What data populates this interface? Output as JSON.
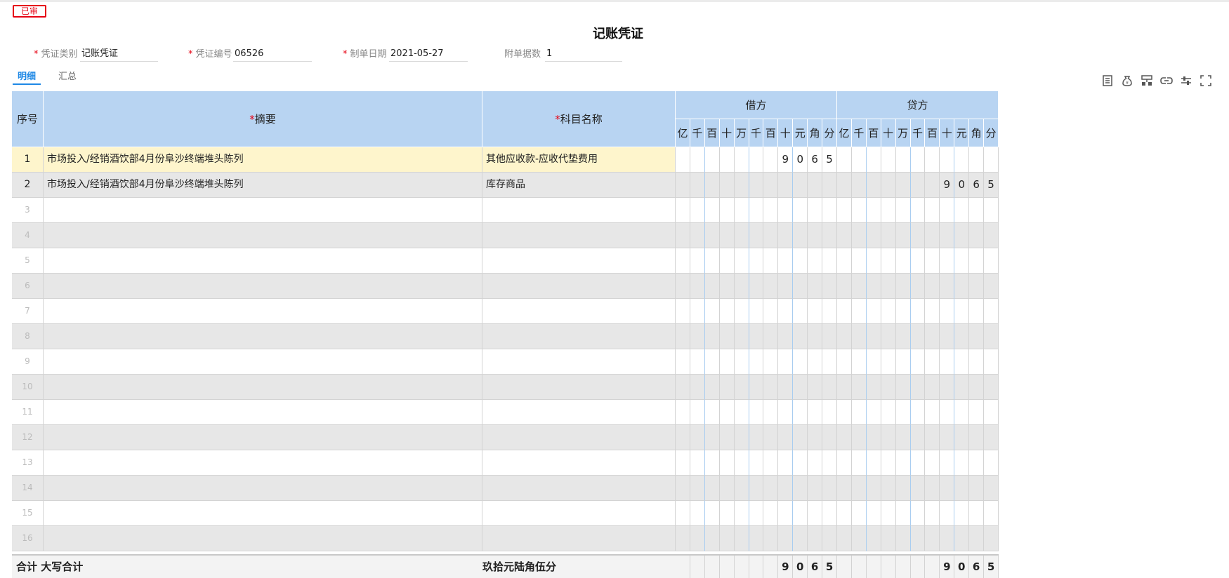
{
  "status_stamp": "已审",
  "title": "记账凭证",
  "header_fields": {
    "voucher_type": {
      "label": "凭证类别",
      "value": "记账凭证",
      "required": "*"
    },
    "voucher_no": {
      "label": "凭证编号",
      "value": "06526",
      "required": "*"
    },
    "date": {
      "label": "制单日期",
      "value": "2021-05-27",
      "required": "*"
    },
    "attachments": {
      "label": "附单据数",
      "value": "1"
    }
  },
  "tabs": {
    "detail": "明细",
    "summary": "汇总"
  },
  "toolbar_icons": [
    "list-icon",
    "money-bag-icon",
    "org-chart-icon",
    "link-icon",
    "adjust-icon",
    "fullscreen-icon"
  ],
  "table": {
    "col_seq": "序号",
    "col_summary": "摘要",
    "col_account": "科目名称",
    "required_mark": "*",
    "debit": "借方",
    "credit": "贷方",
    "digit_headers": [
      "亿",
      "千",
      "百",
      "十",
      "万",
      "千",
      "百",
      "十",
      "元",
      "角",
      "分"
    ],
    "rows": [
      {
        "seq": "1",
        "summary": "市场投入/经销酒饮部4月份阜沙终端堆头陈列",
        "account": "其他应收款-应收代垫费用",
        "debit": [
          "",
          "",
          "",
          "",
          "",
          "",
          "",
          "9",
          "0",
          "6",
          "5"
        ],
        "credit": [
          "",
          "",
          "",
          "",
          "",
          "",
          "",
          "",
          "",
          "",
          ""
        ]
      },
      {
        "seq": "2",
        "summary": "市场投入/经销酒饮部4月份阜沙终端堆头陈列",
        "account": "库存商品",
        "debit": [
          "",
          "",
          "",
          "",
          "",
          "",
          "",
          "",
          "",
          "",
          ""
        ],
        "credit": [
          "",
          "",
          "",
          "",
          "",
          "",
          "",
          "9",
          "0",
          "6",
          "5"
        ]
      },
      {
        "seq": "3",
        "summary": "",
        "account": "",
        "debit": [],
        "credit": []
      },
      {
        "seq": "4",
        "summary": "",
        "account": "",
        "debit": [],
        "credit": []
      },
      {
        "seq": "5",
        "summary": "",
        "account": "",
        "debit": [],
        "credit": []
      },
      {
        "seq": "6",
        "summary": "",
        "account": "",
        "debit": [],
        "credit": []
      },
      {
        "seq": "7",
        "summary": "",
        "account": "",
        "debit": [],
        "credit": []
      },
      {
        "seq": "8",
        "summary": "",
        "account": "",
        "debit": [],
        "credit": []
      },
      {
        "seq": "9",
        "summary": "",
        "account": "",
        "debit": [],
        "credit": []
      },
      {
        "seq": "10",
        "summary": "",
        "account": "",
        "debit": [],
        "credit": []
      },
      {
        "seq": "11",
        "summary": "",
        "account": "",
        "debit": [],
        "credit": []
      },
      {
        "seq": "12",
        "summary": "",
        "account": "",
        "debit": [],
        "credit": []
      },
      {
        "seq": "13",
        "summary": "",
        "account": "",
        "debit": [],
        "credit": []
      },
      {
        "seq": "14",
        "summary": "",
        "account": "",
        "debit": [],
        "credit": []
      },
      {
        "seq": "15",
        "summary": "",
        "account": "",
        "debit": [],
        "credit": []
      },
      {
        "seq": "16",
        "summary": "",
        "account": "",
        "debit": [],
        "credit": []
      }
    ],
    "total": {
      "label": "合计 大写合计",
      "amount_words": "玖拾元陆角伍分",
      "debit": [
        "",
        "",
        "",
        "",
        "",
        "",
        "",
        "9",
        "0",
        "6",
        "5"
      ],
      "credit": [
        "",
        "",
        "",
        "",
        "",
        "",
        "",
        "9",
        "0",
        "6",
        "5"
      ]
    }
  }
}
